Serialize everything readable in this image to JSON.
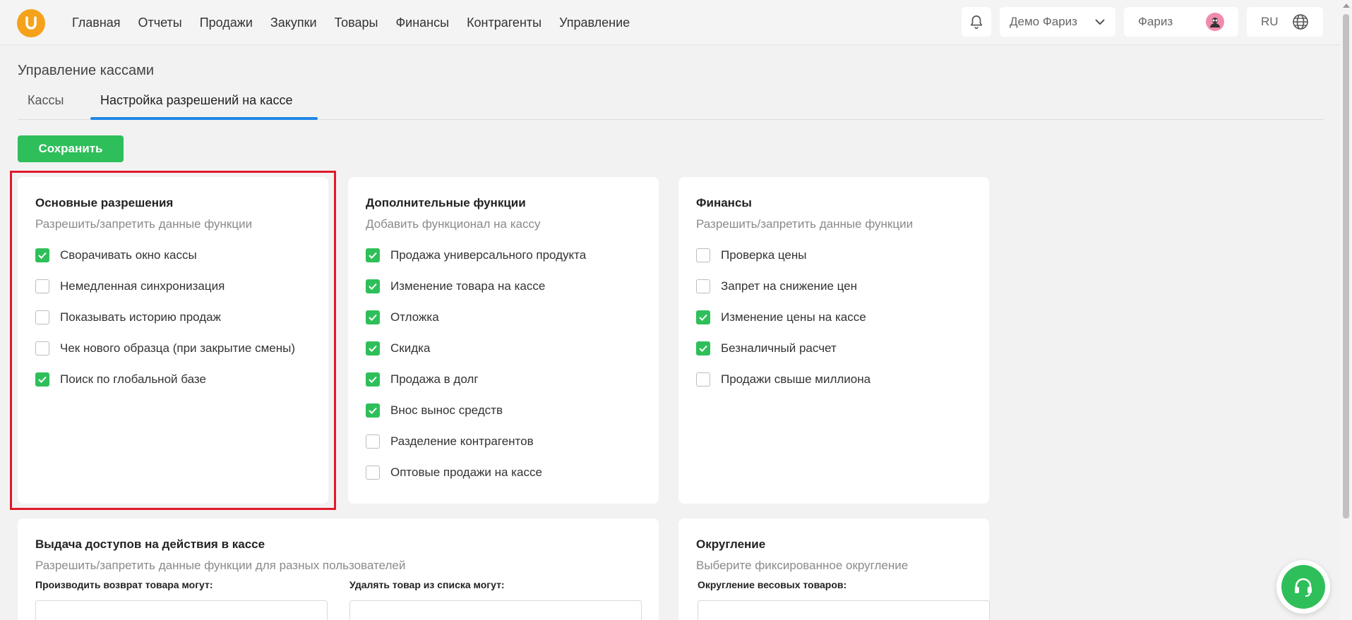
{
  "colors": {
    "accent": "#2fbf5a",
    "tab_underline": "#1e88e5",
    "highlight": "#e0192a",
    "logo": "#f5a21a"
  },
  "logo": {
    "letter": "U",
    "icon": "logo-u-icon"
  },
  "nav": [
    "Главная",
    "Отчеты",
    "Продажи",
    "Закупки",
    "Товары",
    "Финансы",
    "Контрагенты",
    "Управление"
  ],
  "header": {
    "org": "Демо Фариз",
    "user": "Фариз",
    "lang": "RU"
  },
  "page": {
    "title": "Управление кассами",
    "tabs": [
      "Кассы",
      "Настройка разрешений на кассе"
    ],
    "active_tab": 1,
    "save_label": "Сохранить"
  },
  "cards": [
    {
      "title": "Основные разрешения",
      "subtitle": "Разрешить/запретить данные функции",
      "items": [
        {
          "label": "Сворачивать окно кассы",
          "checked": true
        },
        {
          "label": "Немедленная синхронизация",
          "checked": false
        },
        {
          "label": "Показывать историю продаж",
          "checked": false
        },
        {
          "label": "Чек нового образца (при закрытие смены)",
          "checked": false
        },
        {
          "label": "Поиск по глобальной базе",
          "checked": true
        }
      ]
    },
    {
      "title": "Дополнительные функции",
      "subtitle": "Добавить функционал на кассу",
      "items": [
        {
          "label": "Продажа универсального продукта",
          "checked": true
        },
        {
          "label": "Изменение товара на кассе",
          "checked": true
        },
        {
          "label": "Отложка",
          "checked": true
        },
        {
          "label": "Скидка",
          "checked": true
        },
        {
          "label": "Продажа в долг",
          "checked": true
        },
        {
          "label": "Внос вынос средств",
          "checked": true
        },
        {
          "label": "Разделение контрагентов",
          "checked": false
        },
        {
          "label": "Оптовые продажи на кассе",
          "checked": false
        }
      ]
    },
    {
      "title": "Финансы",
      "subtitle": "Разрешить/запретить данные функции",
      "items": [
        {
          "label": "Проверка цены",
          "checked": false
        },
        {
          "label": "Запрет на снижение цен",
          "checked": false
        },
        {
          "label": "Изменение цены на кассе",
          "checked": true
        },
        {
          "label": "Безналичный расчет",
          "checked": true
        },
        {
          "label": "Продажи свыше миллиона",
          "checked": false
        }
      ]
    }
  ],
  "access": {
    "title": "Выдача доступов на действия в кассе",
    "subtitle": "Разрешить/запретить данные функции для разных пользователей",
    "field1_label": "Производить возврат товара могут:",
    "field2_label": "Удалять товар из списка могут:"
  },
  "rounding": {
    "title": "Округление",
    "subtitle": "Выберите фиксированное округление",
    "field_label": "Округление весовых товаров:"
  }
}
